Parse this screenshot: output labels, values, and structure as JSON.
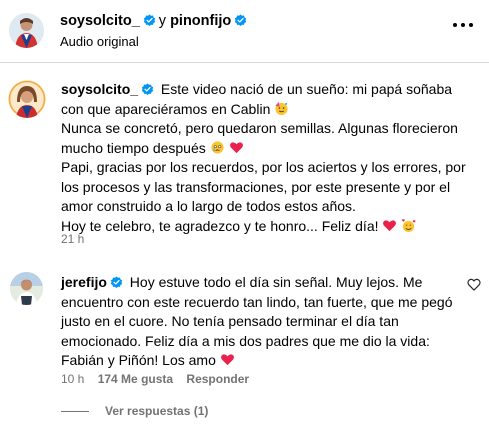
{
  "header": {
    "user1": "soysolcito_",
    "separator": "y",
    "user2": "pinonfijo",
    "subtitle": "Audio original",
    "more_icon": "more-horizontal-icon"
  },
  "caption": {
    "username": "soysolcito_",
    "line1": "Este video nació de un sueño: mi papá soñaba con que apareciéramos en Cablin",
    "line2": "Nunca se concretó, pero quedaron semillas. Algunas florecieron mucho tiempo después",
    "line3": "Papi, gracias por los recuerdos, por los aciertos y los errores, por los procesos y las transformaciones, por este presente y por el amor construido a lo largo de todos estos años.",
    "line4": "Hoy te celebro, te agradezco y te honro... Feliz día!",
    "time": "21 h"
  },
  "comment": {
    "username": "jerefijo",
    "text": "Hoy estuve todo el día sin señal. Muy lejos. Me encuentro con este recuerdo tan lindo, tan fuerte, que me pegó justo en el cuore. No tenía pensado terminar el día tan emocionado. Feliz día a mis dos padres que me dio la vida: Fabián y Piñón! Los amo",
    "time": "10 h",
    "likes": "174 Me gusta",
    "reply_label": "Responder",
    "view_replies": "Ver respuestas (1)"
  },
  "colors": {
    "verified_blue": "#0095f6",
    "muted_text": "#737373",
    "heart_red": "#e8224d"
  }
}
